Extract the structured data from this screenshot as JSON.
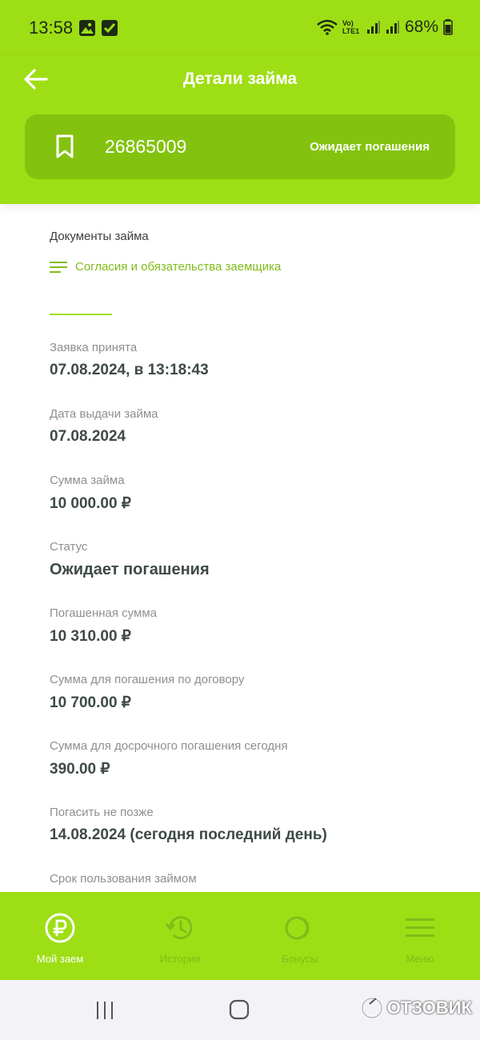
{
  "status_bar": {
    "time": "13:58",
    "battery": "68%",
    "network": "Vo) LTE1"
  },
  "header": {
    "title": "Детали займа",
    "loan_number": "26865009",
    "loan_status": "Ожидает погашения"
  },
  "documents": {
    "label": "Документы займа",
    "link": "Согласия и обязательства заемщика"
  },
  "fields": [
    {
      "label": "Заявка принята",
      "value": "07.08.2024, в 13:18:43"
    },
    {
      "label": "Дата выдачи займа",
      "value": "07.08.2024"
    },
    {
      "label": "Сумма займа",
      "value": "10 000.00 ₽"
    },
    {
      "label": "Статус",
      "value": "Ожидает погашения"
    },
    {
      "label": "Погашенная сумма",
      "value": "10 310.00 ₽"
    },
    {
      "label": "Сумма для погашения по договору",
      "value": "10 700.00 ₽"
    },
    {
      "label": "Сумма для досрочного погашения сегодня",
      "value": "390.00 ₽"
    },
    {
      "label": "Погасить не позже",
      "value": "14.08.2024 (сегодня последний день)"
    },
    {
      "label": "Срок пользования займом",
      "value": ""
    }
  ],
  "bottom_nav": [
    {
      "label": "Мой заем",
      "icon": "ruble-icon",
      "active": true
    },
    {
      "label": "История",
      "icon": "history-icon",
      "active": false
    },
    {
      "label": "Бонусы",
      "icon": "bonus-icon",
      "active": false
    },
    {
      "label": "Меню",
      "icon": "menu-icon",
      "active": false
    }
  ],
  "watermark": "ОТЗОВИК",
  "colors": {
    "brand_green": "#9ede15",
    "card_green": "#83c30f",
    "link_green": "#80bd1b"
  }
}
